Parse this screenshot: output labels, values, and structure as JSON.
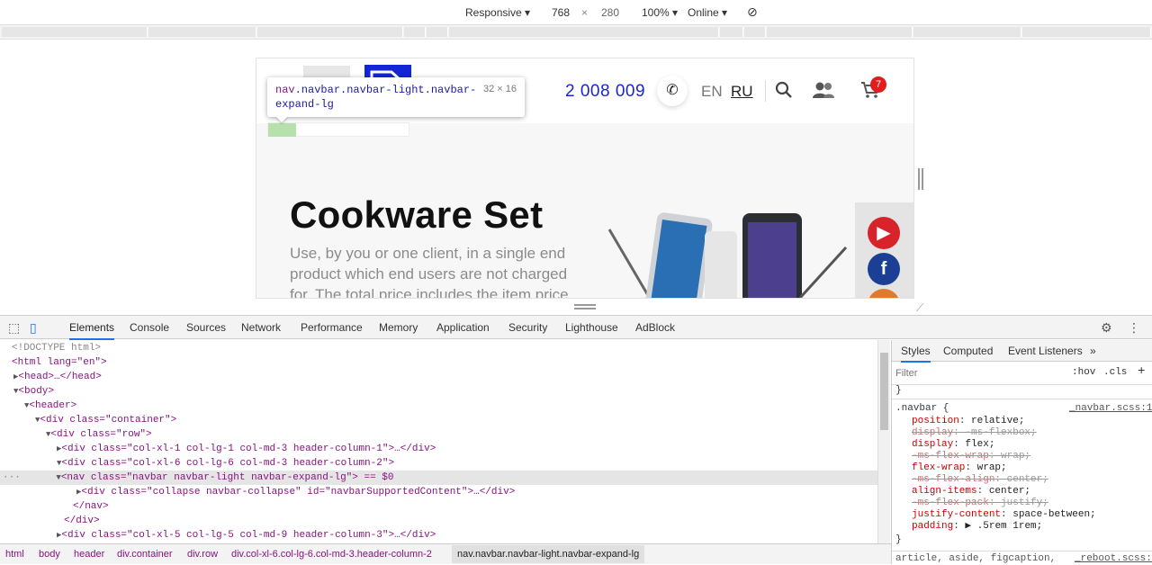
{
  "device_toolbar": {
    "mode": "Responsive",
    "width": "768",
    "times": "×",
    "height": "280",
    "zoom": "100%",
    "network": "Online"
  },
  "site": {
    "phone": "2 008 009",
    "lang_en": "EN",
    "lang_ru": "RU",
    "cart_count": "7",
    "hero_title": "Cookware Set",
    "hero_text": "Use, by you or one client, in a single end product which end users are not charged for. The total price includes the item price"
  },
  "tooltip": {
    "selector_tag": "nav",
    "selector_classes": ".navbar.navbar-light.navbar-expand-lg",
    "size": "32 × 16"
  },
  "devtools": {
    "tabs": [
      "Elements",
      "Console",
      "Sources",
      "Network",
      "Performance",
      "Memory",
      "Application",
      "Security",
      "Lighthouse",
      "AdBlock"
    ],
    "active_tab": "Elements",
    "dom_lines": [
      "<!DOCTYPE html>",
      "<html lang=\"en\">",
      "<head>…</head>",
      "<body>",
      "<header>",
      "<div class=\"container\">",
      "<div class=\"row\">",
      "<div class=\"col-xl-1 col-lg-1 col-md-3 header-column-1\">…</div>",
      "<div class=\"col-xl-6 col-lg-6 col-md-3 header-column-2\">",
      "<nav class=\"navbar navbar-light navbar-expand-lg\"> == $0",
      "<div class=\"collapse navbar-collapse\" id=\"navbarSupportedContent\">…</div>",
      "</nav>",
      "</div>",
      "<div class=\"col-xl-5 col-lg-5 col-md-9 header-column-3\">…</div>"
    ],
    "breadcrumbs": [
      "html",
      "body",
      "header",
      "div.container",
      "div.row",
      "div.col-xl-6.col-lg-6.col-md-3.header-column-2",
      "nav.navbar.navbar-light.navbar-expand-lg"
    ],
    "styles": {
      "tabs": [
        "Styles",
        "Computed",
        "Event Listeners",
        "»"
      ],
      "filter_placeholder": "Filter",
      "hov": ":hov",
      "cls": ".cls",
      "plus": "+",
      "open_brace": "}",
      "rule_selector": ".navbar {",
      "rule_source": "_navbar.scss:19",
      "declarations": [
        {
          "prop": "position",
          "val": "relative;",
          "struck": false
        },
        {
          "prop": "display",
          "val": "-ms-flexbox;",
          "struck": true
        },
        {
          "prop": "display",
          "val": "flex;",
          "struck": false
        },
        {
          "prop": "-ms-flex-wrap",
          "val": "wrap;",
          "struck": true
        },
        {
          "prop": "flex-wrap",
          "val": "wrap;",
          "struck": false
        },
        {
          "prop": "-ms-flex-align",
          "val": "center;",
          "struck": true
        },
        {
          "prop": "align-items",
          "val": "center;",
          "struck": false
        },
        {
          "prop": "-ms-flex-pack",
          "val": "justify;",
          "struck": true
        },
        {
          "prop": "justify-content",
          "val": "space-between;",
          "struck": false
        },
        {
          "prop": "padding",
          "val": "▶ .5rem 1rem;",
          "struck": false
        }
      ],
      "close_brace": "}",
      "next_rule": "article, aside, figcaption,",
      "next_source": "_reboot.scss:36"
    }
  }
}
